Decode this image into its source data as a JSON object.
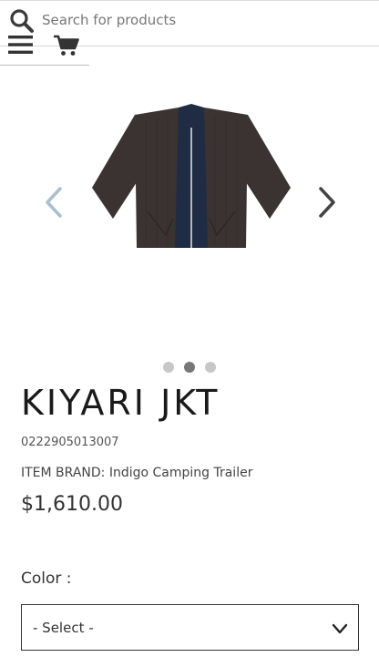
{
  "header": {
    "search": {
      "placeholder": "Search for products",
      "value": "",
      "icon": "search-icon"
    },
    "menu_icon": "hamburger-menu-icon",
    "cart_icon": "shopping-cart-icon"
  },
  "carousel": {
    "image_alt": "KIYARI JKT jacket",
    "prev_icon": "chevron-left-icon",
    "next_icon": "chevron-right-icon",
    "slide_count": 3,
    "active_slide": 2
  },
  "product": {
    "title": "KIYARI JKT",
    "sku": "0222905013007",
    "brand_text": "ITEM BRAND: Indigo Camping Trailer",
    "price": "$1,610.00"
  },
  "options": {
    "color_label": "Color :",
    "color_selected": "- Select -",
    "dropdown_icon": "chevron-down-icon"
  },
  "colors": {
    "text": "#222222",
    "border": "#333333",
    "dot_inactive": "#c7c7c7",
    "dot_active": "#777777",
    "arrow_prev": "#a9bfcf",
    "arrow_next": "#444444",
    "jacket_body": "#3b3331",
    "jacket_collar": "#1f2c44"
  }
}
